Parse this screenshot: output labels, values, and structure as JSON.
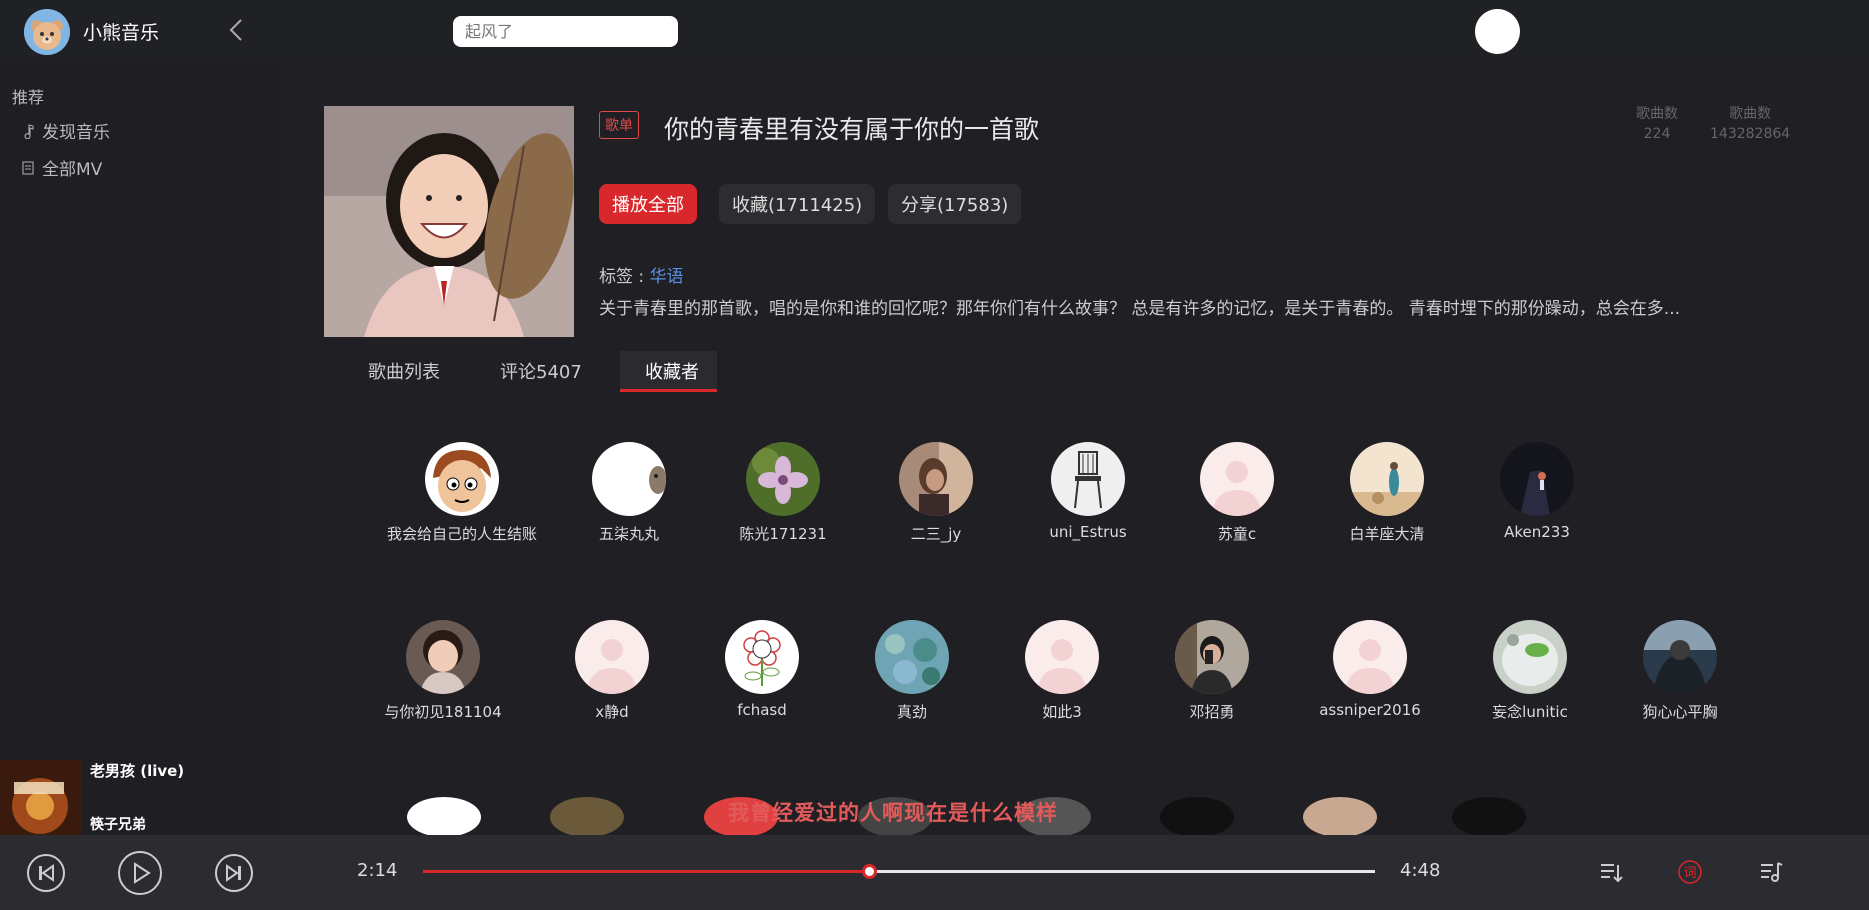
{
  "app": {
    "name": "小熊音乐"
  },
  "search": {
    "placeholder": "起风了"
  },
  "sidebar": {
    "section": "推荐",
    "items": [
      {
        "label": "发现音乐",
        "icon": "music-note-icon"
      },
      {
        "label": "全部MV",
        "icon": "document-icon"
      }
    ]
  },
  "playlist": {
    "badge": "歌单",
    "title": "你的青春里有没有属于你的一首歌",
    "stats": [
      {
        "label": "歌曲数",
        "value": "224"
      },
      {
        "label": "歌曲数",
        "value": "143282864"
      }
    ],
    "buttons": {
      "play_all": "播放全部",
      "collect": "收藏(1711425)",
      "share": "分享(17583)"
    },
    "tags_label": "标签 : ",
    "tag": "华语",
    "description": "关于青春里的那首歌，唱的是你和谁的回忆呢？那年你们有什么故事？ 总是有许多的记忆，是关于青春的。 青春时埋下的那份躁动，总会在多..."
  },
  "tabs": [
    {
      "label": "歌曲列表",
      "active": false
    },
    {
      "label": "评论5407",
      "active": false
    },
    {
      "label": "收藏者",
      "active": true
    }
  ],
  "favorites": {
    "row1": [
      {
        "name": "我会给自己的人生结账"
      },
      {
        "name": "五柒丸丸"
      },
      {
        "name": "陈光171231"
      },
      {
        "name": "二三_jy"
      },
      {
        "name": "uni_Estrus"
      },
      {
        "name": "苏童c"
      },
      {
        "name": "白羊座大清"
      },
      {
        "name": "Aken233"
      }
    ],
    "row2": [
      {
        "name": "与你初见181104"
      },
      {
        "name": "x静d"
      },
      {
        "name": "fchasd"
      },
      {
        "name": "真劲"
      },
      {
        "name": "如此3"
      },
      {
        "name": "邓招勇"
      },
      {
        "name": "assniper2016"
      },
      {
        "name": "妄念lunitic"
      },
      {
        "name": "狗心心平胸"
      }
    ]
  },
  "now_playing": {
    "song": "老男孩 (live)",
    "artist": "筷子兄弟",
    "lyric": "我曾经爱过的人啊现在是什么模样",
    "current_time": "2:14",
    "total_time": "4:48",
    "progress": 0.468
  },
  "player_icons": {
    "prev": "skip-previous-icon",
    "play": "play-icon",
    "next": "skip-next-icon",
    "playlist": "playlist-icon",
    "lyrics": "lyrics-icon",
    "lyrics_glyph": "词",
    "queue": "queue-music-icon"
  },
  "colors": {
    "accent": "#d9282b",
    "link": "#5b8fe0",
    "lyric": "#e25a5a"
  }
}
